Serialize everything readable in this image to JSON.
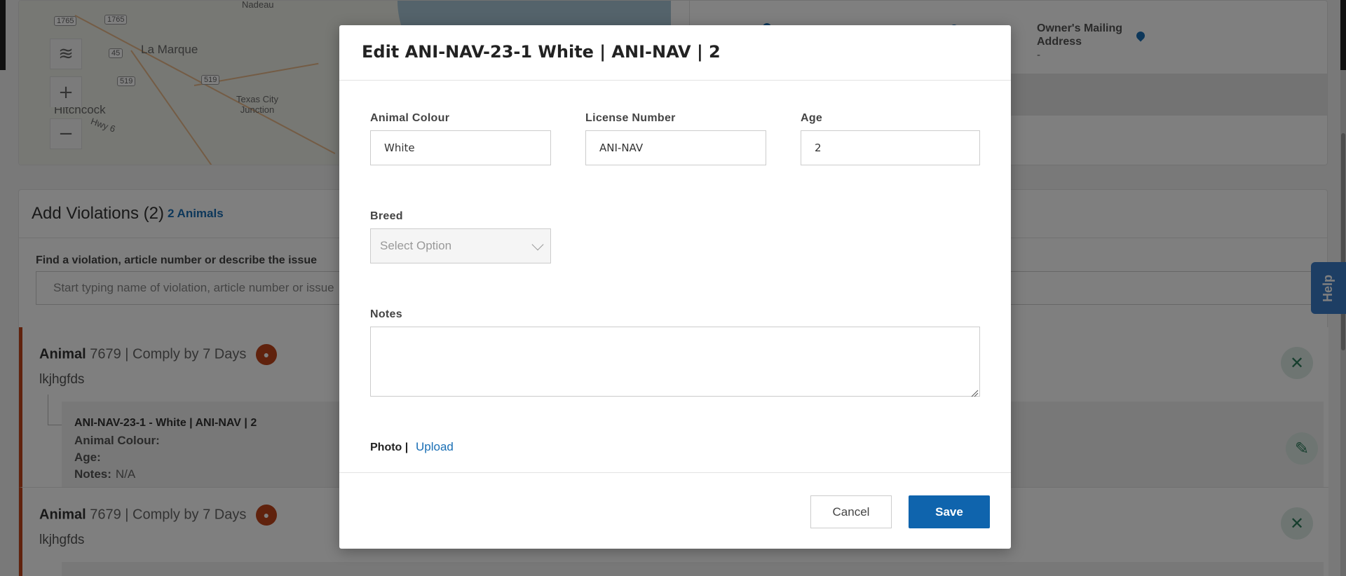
{
  "background": {
    "map": {
      "labels": [
        "Nadeau",
        "La Marque",
        "Hitchcock",
        "Texas City Junction",
        "Hwy 6"
      ],
      "shields": [
        "1765",
        "1765",
        "45",
        "519",
        "519"
      ],
      "layers_icon": "layers-icon",
      "zoom_in": "+",
      "zoom_out": "−"
    },
    "owner_mailing_address": {
      "label": "Owner's Mailing Address",
      "value": "-"
    },
    "violations": {
      "title": "Add Violations (2)",
      "animals_link": "2 Animals",
      "find_label": "Find a violation, article number or describe the issue",
      "find_placeholder": "Start typing name of violation, article number or issue",
      "items": [
        {
          "type": "Animal",
          "meta": "7679 | Comply by 7 Days",
          "description": "lkjhgfds",
          "sub_item": {
            "title": "ANI-NAV-23-1 - White | ANI-NAV | 2",
            "colour_label": "Animal Colour:",
            "colour_value": "",
            "age_label": "Age:",
            "age_value": "",
            "notes_label": "Notes:",
            "notes_value": "N/A"
          }
        },
        {
          "type": "Animal",
          "meta": "7679 | Comply by 7 Days",
          "description": "lkjhgfds"
        }
      ]
    },
    "help_label": "Help"
  },
  "modal": {
    "title": "Edit ANI-NAV-23-1 White | ANI-NAV | 2",
    "fields": {
      "animal_colour": {
        "label": "Animal Colour",
        "value": "White"
      },
      "license_number": {
        "label": "License Number",
        "value": "ANI-NAV"
      },
      "age": {
        "label": "Age",
        "value": "2"
      },
      "breed": {
        "label": "Breed",
        "placeholder": "Select Option"
      },
      "notes": {
        "label": "Notes",
        "value": ""
      }
    },
    "photo_label": "Photo |",
    "upload_label": "Upload",
    "cancel_label": "Cancel",
    "save_label": "Save"
  },
  "colors": {
    "primary": "#0f64ad",
    "accent_violation": "#c0441b",
    "link": "#1a6fb5",
    "success_icon": "#2f7d5c",
    "help_tab": "#3a7cc9"
  }
}
